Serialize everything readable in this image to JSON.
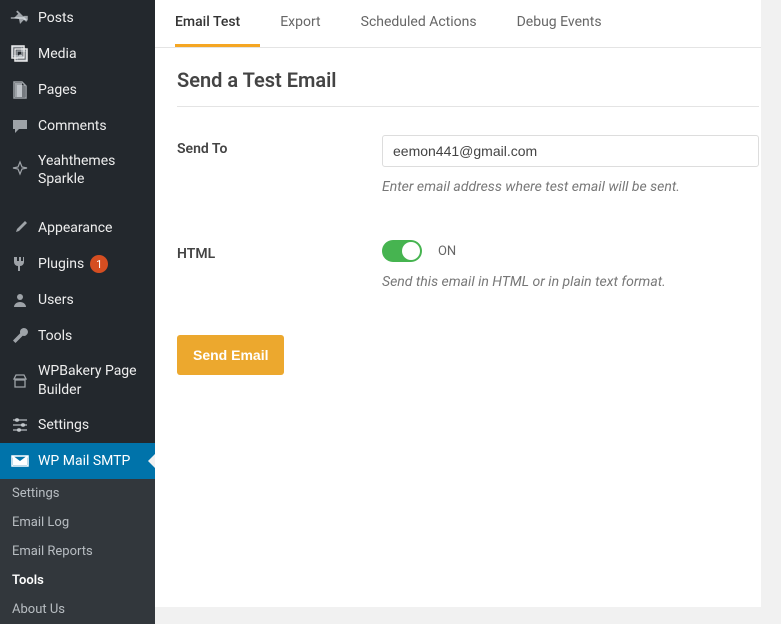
{
  "sidebar": {
    "items": [
      {
        "label": "Posts"
      },
      {
        "label": "Media"
      },
      {
        "label": "Pages"
      },
      {
        "label": "Comments"
      },
      {
        "label": "Yeahthemes Sparkle"
      },
      {
        "label": "Appearance"
      },
      {
        "label": "Plugins",
        "badge": "1"
      },
      {
        "label": "Users"
      },
      {
        "label": "Tools"
      },
      {
        "label": "WPBakery Page Builder"
      },
      {
        "label": "Settings"
      },
      {
        "label": "WP Mail SMTP"
      }
    ],
    "submenu": [
      {
        "label": "Settings"
      },
      {
        "label": "Email Log"
      },
      {
        "label": "Email Reports"
      },
      {
        "label": "Tools"
      },
      {
        "label": "About Us"
      }
    ]
  },
  "tabs": [
    {
      "label": "Email Test"
    },
    {
      "label": "Export"
    },
    {
      "label": "Scheduled Actions"
    },
    {
      "label": "Debug Events"
    }
  ],
  "page": {
    "title": "Send a Test Email",
    "sendto_label": "Send To",
    "sendto_value": "eemon441@gmail.com",
    "sendto_help": "Enter email address where test email will be sent.",
    "html_label": "HTML",
    "html_state": "ON",
    "html_help": "Send this email in HTML or in plain text format.",
    "button": "Send Email"
  }
}
